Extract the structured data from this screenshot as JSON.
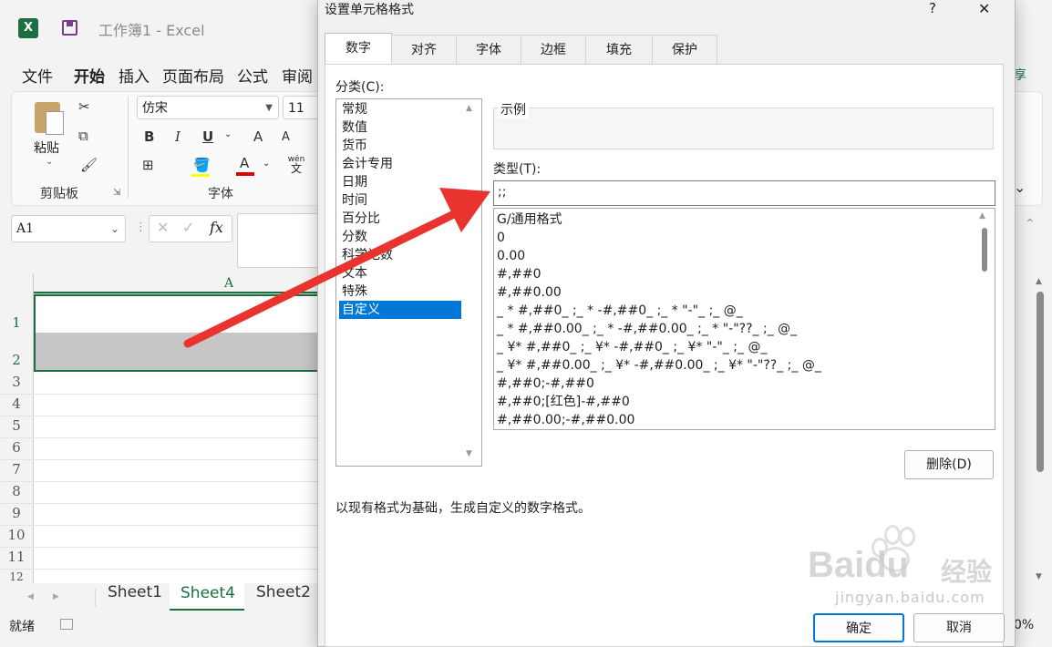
{
  "app": {
    "title": "工作簿1 - Excel",
    "logo": "X",
    "share_partial": "享"
  },
  "menu": [
    "文件",
    "开始",
    "插入",
    "页面布局",
    "公式",
    "审阅"
  ],
  "ribbon": {
    "paste_label": "粘贴",
    "clipboard_group": "剪贴板",
    "font_name": "仿宋",
    "font_size": "11",
    "bold": "B",
    "italic": "I",
    "underline": "U",
    "grow_font": "A",
    "shrink_font": "A",
    "font_color": "A",
    "phonetic_top": "wén",
    "phonetic_bottom": "文",
    "font_group": "字体"
  },
  "formula_bar": {
    "name_box": "A1",
    "fx": "fx"
  },
  "grid": {
    "column_a": "A",
    "rows": [
      "1",
      "2",
      "3",
      "4",
      "5",
      "6",
      "7",
      "8",
      "9",
      "10",
      "11",
      "12"
    ]
  },
  "sheet_tabs": [
    "Sheet1",
    "Sheet4",
    "Sheet2"
  ],
  "active_sheet": "Sheet4",
  "status": {
    "ready": "就绪",
    "zoom_partial": "0%"
  },
  "dialog": {
    "title": "设置单元格格式",
    "help": "?",
    "close": "✕",
    "tabs": [
      "数字",
      "对齐",
      "字体",
      "边框",
      "填充",
      "保护"
    ],
    "category_label": "分类(C):",
    "categories": [
      "常规",
      "数值",
      "货币",
      "会计专用",
      "日期",
      "时间",
      "百分比",
      "分数",
      "科学记数",
      "文本",
      "特殊",
      "自定义"
    ],
    "selected_category": "自定义",
    "sample_label": "示例",
    "type_label": "类型(T):",
    "type_value": ";;",
    "formats": [
      "G/通用格式",
      "0",
      "0.00",
      "#,##0",
      "#,##0.00",
      "_ * #,##0_ ;_ * -#,##0_ ;_ * \"-\"_ ;_ @_",
      "_ * #,##0.00_ ;_ * -#,##0.00_ ;_ * \"-\"??_ ;_ @_",
      "_ ¥* #,##0_ ;_ ¥* -#,##0_ ;_ ¥* \"-\"_ ;_ @_",
      "_ ¥* #,##0.00_ ;_ ¥* -#,##0.00_ ;_ ¥* \"-\"??_ ;_ @_",
      "#,##0;-#,##0",
      "#,##0;[红色]-#,##0",
      "#,##0.00;-#,##0.00"
    ],
    "delete_button": "删除(D)",
    "description": "以现有格式为基础，生成自定义的数字格式。",
    "ok_button": "确定",
    "cancel_button": "取消"
  },
  "watermark": {
    "brand": "Baidu",
    "cn": "经验",
    "url": "jingyan.baidu.com"
  },
  "colors": {
    "excel_green": "#1d6f42",
    "selection_blue": "#0078d7",
    "arrow_red": "#e8332e",
    "font_color_red": "#e00000"
  }
}
